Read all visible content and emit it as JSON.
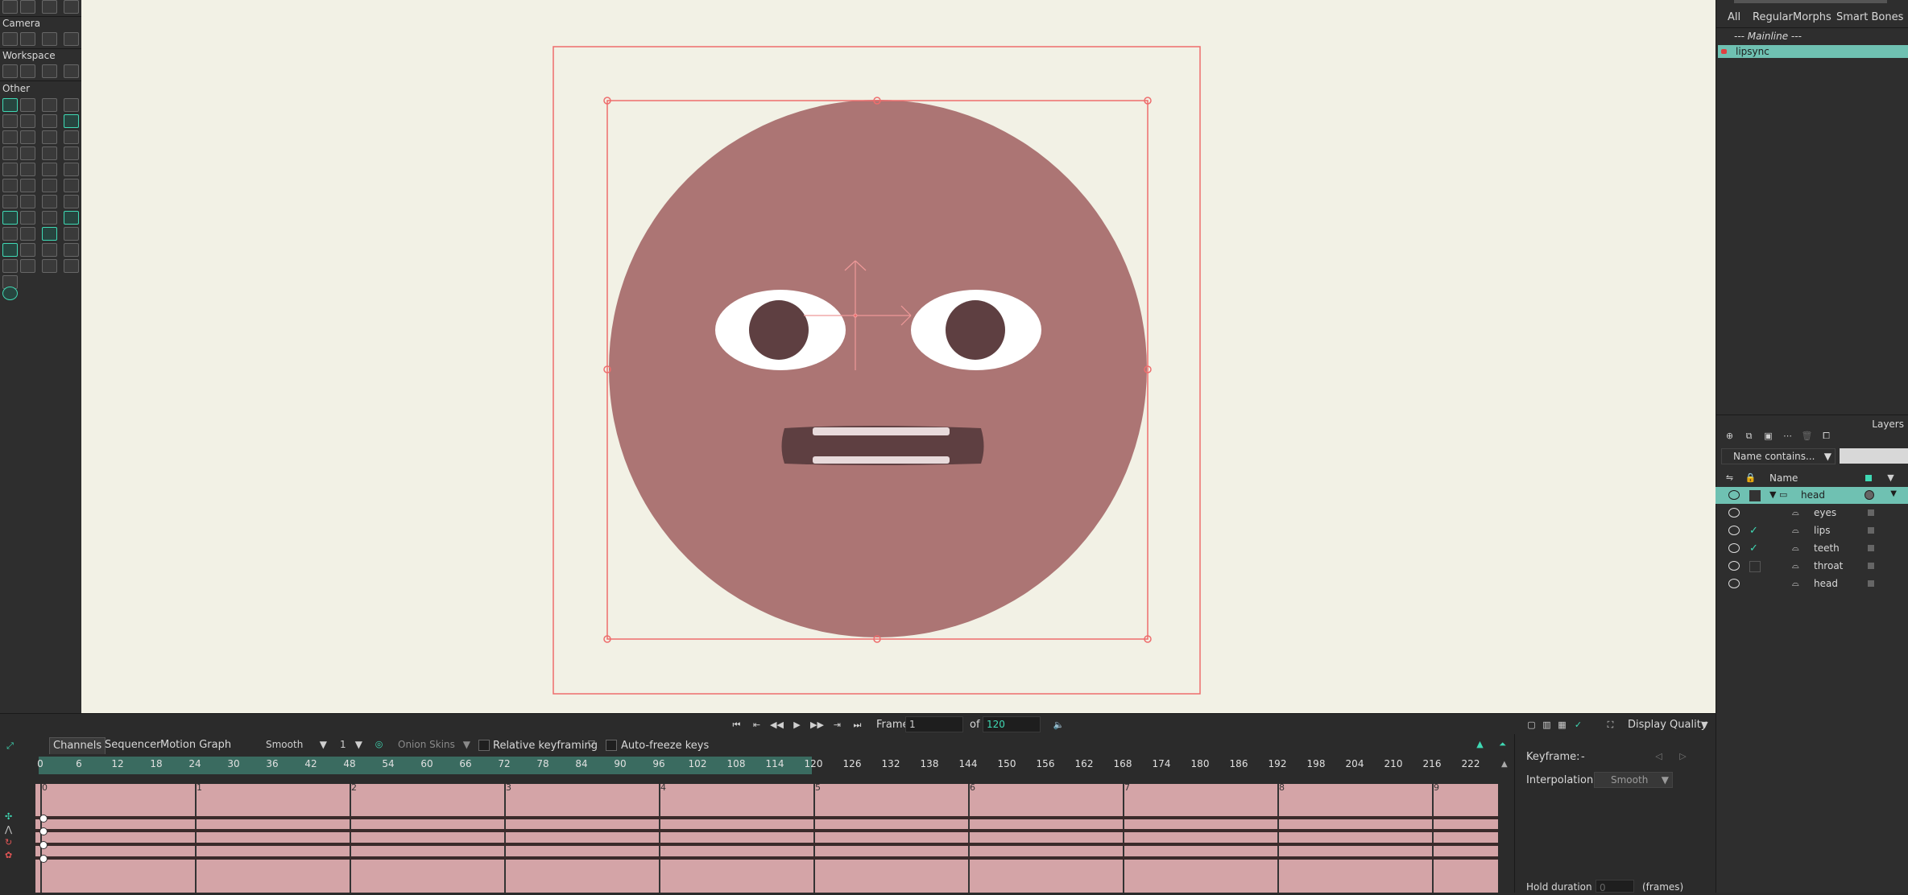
{
  "toolbox": {
    "sections": {
      "camera": "Camera",
      "workspace": "Workspace",
      "other": "Other"
    }
  },
  "transport": {
    "frame_label": "Frame",
    "frame_value": "1",
    "of_label": "of",
    "total_frames": "120",
    "display_quality": "Display Quality"
  },
  "timeline": {
    "tabs": [
      "Channels",
      "Sequencer",
      "Motion Graph"
    ],
    "interpolation": "Smooth",
    "step": "1",
    "onion_skins": "Onion Skins",
    "relative_keyframing": "Relative keyframing",
    "auto_freeze": "Auto-freeze keys",
    "ruler_ticks": [
      "0",
      "6",
      "12",
      "18",
      "24",
      "30",
      "36",
      "42",
      "48",
      "54",
      "60",
      "66",
      "72",
      "78",
      "84",
      "90",
      "96",
      "102",
      "108",
      "114",
      "120",
      "126",
      "132",
      "138",
      "144",
      "150",
      "156",
      "162",
      "168",
      "174",
      "180",
      "186",
      "192",
      "198",
      "204",
      "210",
      "216",
      "222"
    ],
    "played_through": 120,
    "seconds": [
      "0",
      "1",
      "2",
      "3",
      "4",
      "5",
      "6",
      "7",
      "8",
      "9"
    ]
  },
  "keyframe_panel": {
    "keyframe_label": "Keyframe:",
    "keyframe_value": "-",
    "interpolation_label": "Interpolation:",
    "interpolation_value": "Smooth",
    "hold_label": "Hold duration",
    "hold_value": "0",
    "hold_unit": "(frames)"
  },
  "actions_panel": {
    "tabs": [
      "All",
      "Regular",
      "Morphs",
      "Smart Bones"
    ],
    "mainline": "--- Mainline ---",
    "selected": "lipsync"
  },
  "layers_panel": {
    "title": "Layers",
    "filter": "Name contains...",
    "name_header": "Name",
    "rows": [
      {
        "name": "head",
        "checked": false,
        "group": true
      },
      {
        "name": "eyes",
        "checked": false,
        "group": false
      },
      {
        "name": "lips",
        "checked": true,
        "group": false
      },
      {
        "name": "teeth",
        "checked": true,
        "group": false
      },
      {
        "name": "throat",
        "checked": false,
        "group": false
      },
      {
        "name": "head",
        "checked": false,
        "group": false
      }
    ]
  },
  "colors": {
    "accent": "#3fd9b4",
    "canvas_bg": "#f2f1e5",
    "face": "#ac7574",
    "pupil": "#5e3f41",
    "selection": "#ee6d6d",
    "track_bg": "#d4a4a7"
  }
}
